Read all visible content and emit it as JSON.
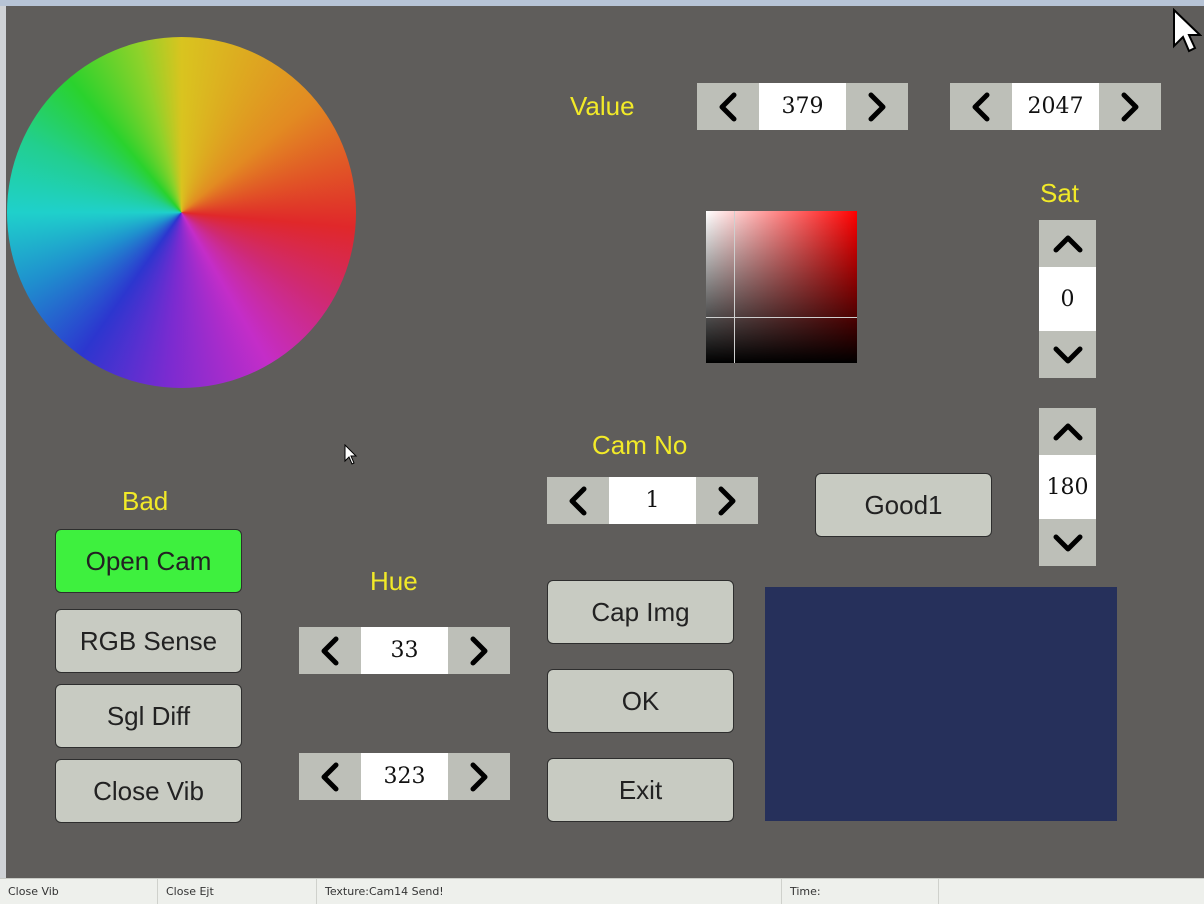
{
  "labels": {
    "value": "Value",
    "sat": "Sat",
    "cam_no": "Cam No",
    "bad": "Bad",
    "hue": "Hue"
  },
  "spinners": {
    "value_low": "379",
    "value_high": "2047",
    "sat_top": "0",
    "sat_bottom": "180",
    "cam_no": "1",
    "hue_low": "33",
    "hue_high": "323"
  },
  "buttons": {
    "good1": "Good1",
    "open_cam": "Open Cam",
    "rgb_sense": "RGB Sense",
    "sgl_diff": "Sgl Diff",
    "close_vib": "Close Vib",
    "cap_img": "Cap Img",
    "ok": "OK",
    "exit": "Exit"
  },
  "status": {
    "close_vib": "Close Vib",
    "close_ejt": "Close Ejt",
    "texture": "Texture:Cam14  Send!",
    "time": "Time:"
  },
  "colors": {
    "label_yellow": "#f2ea28",
    "open_cam_green": "#3ef03e",
    "preview_navy": "#26305b"
  }
}
